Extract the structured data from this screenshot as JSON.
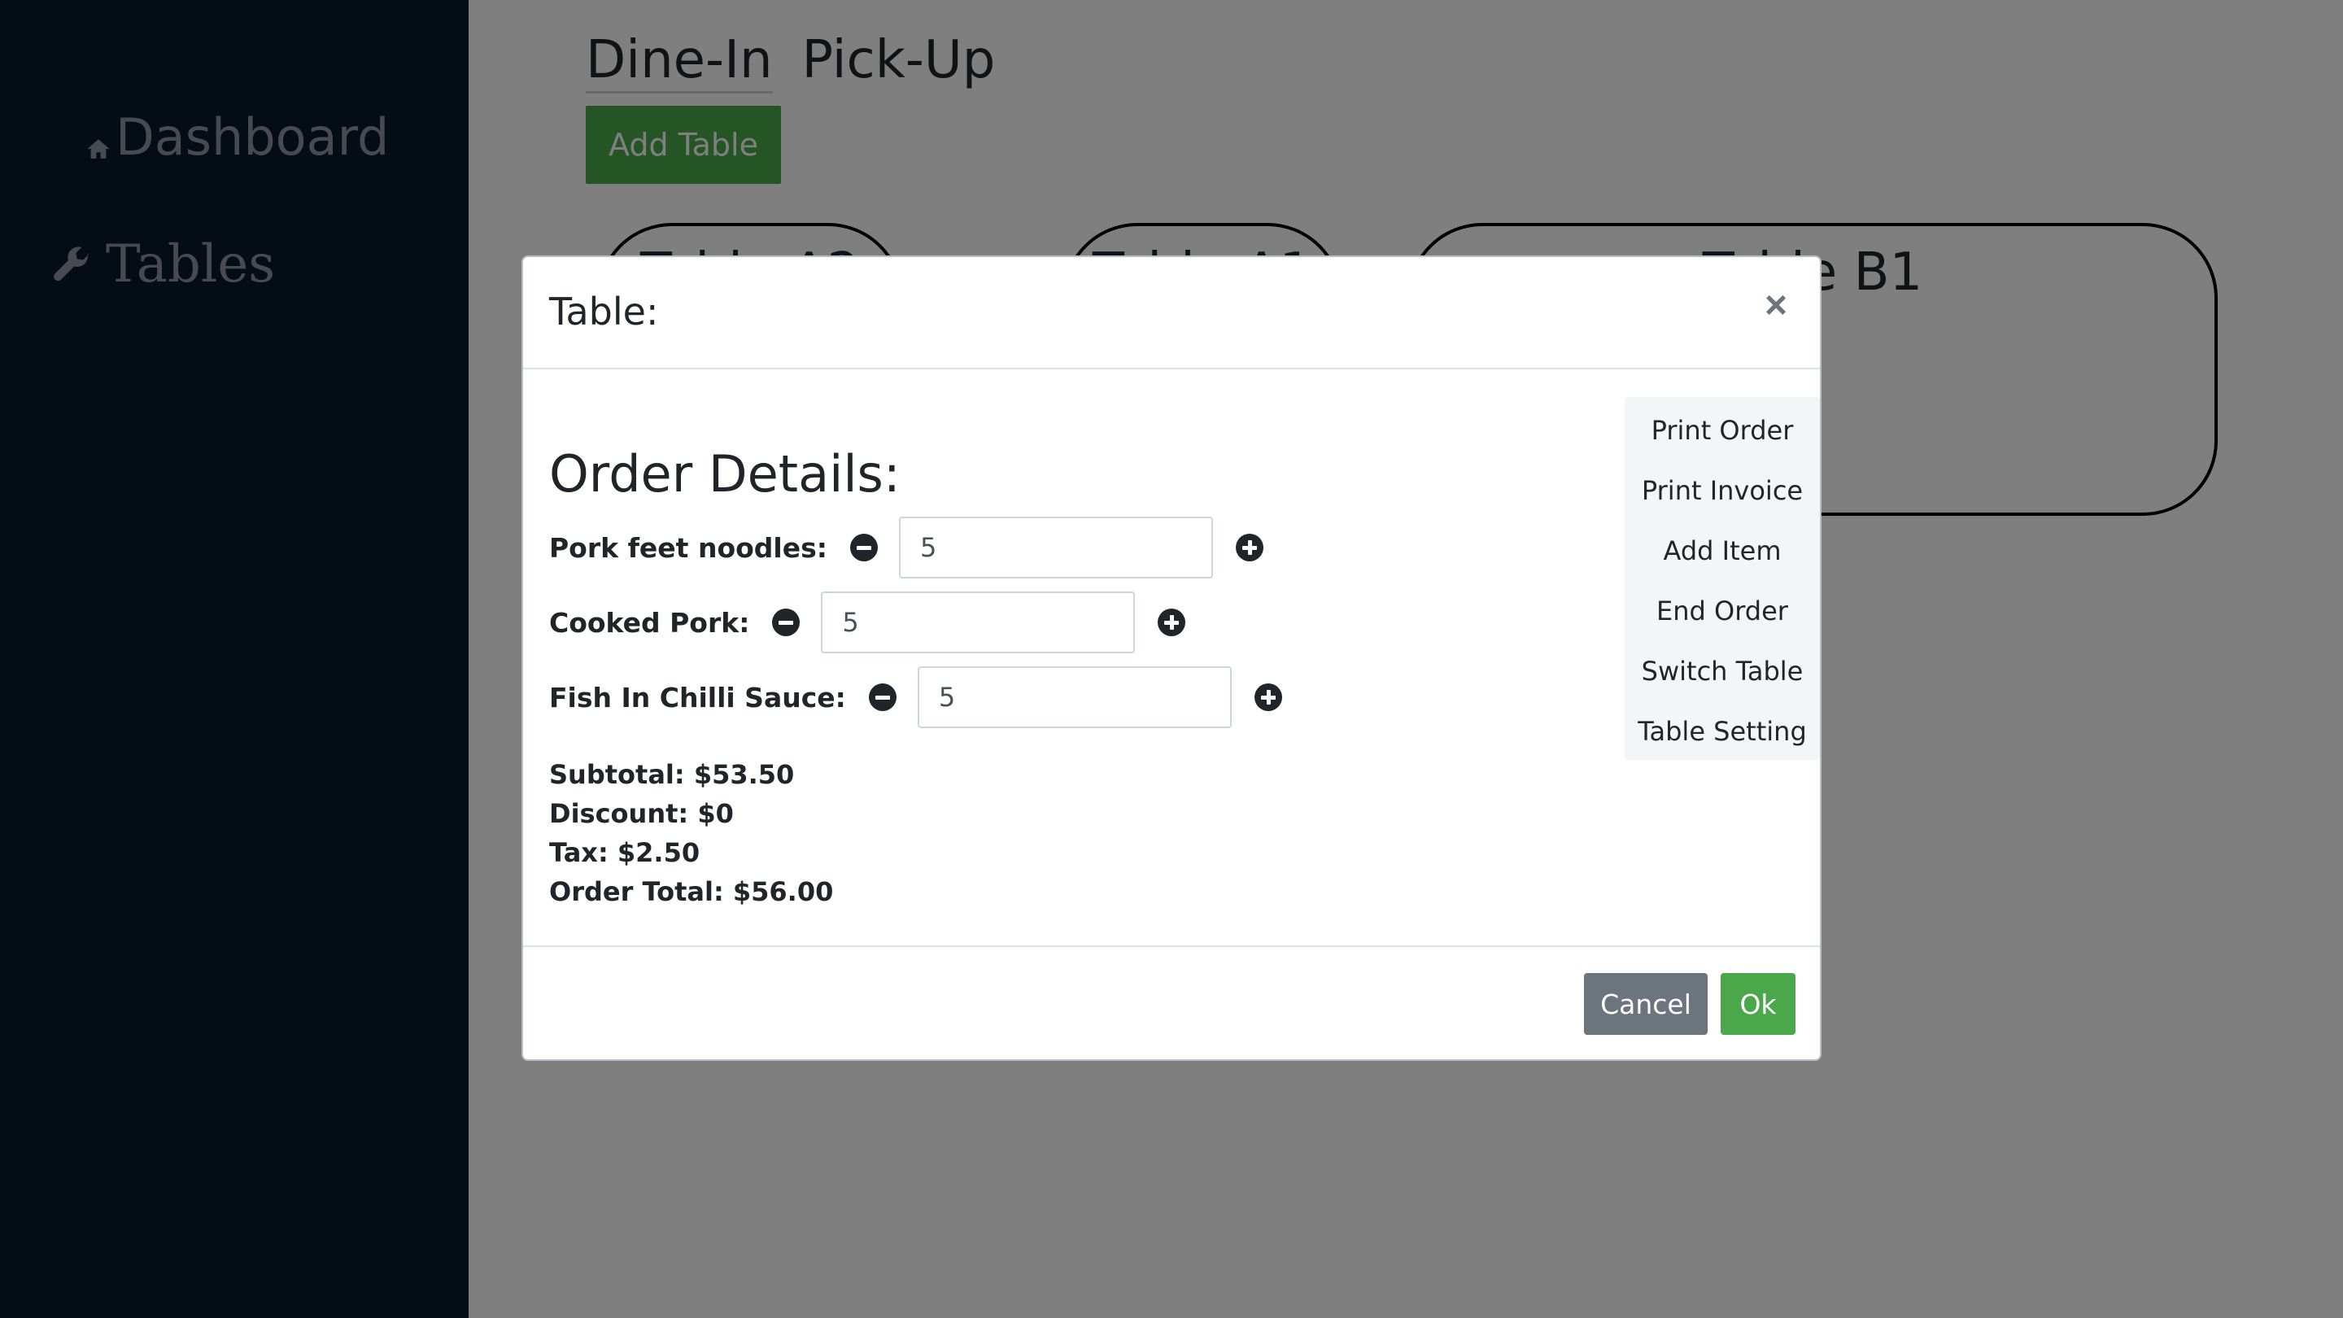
{
  "sidebar": {
    "items": [
      {
        "label": "Dashboard",
        "icon": "home-icon"
      },
      {
        "label": "Tables",
        "icon": "wrench-icon"
      }
    ]
  },
  "main": {
    "tabs": [
      {
        "label": "Dine-In",
        "active": true
      },
      {
        "label": "Pick-Up",
        "active": false
      }
    ],
    "add_table_label": "Add Table",
    "tables": [
      {
        "name": "Table A2"
      },
      {
        "name": "Table A1"
      },
      {
        "name": "Table B1"
      }
    ]
  },
  "modal": {
    "title": "Table:",
    "close_label": "×",
    "heading": "Order Details:",
    "items": [
      {
        "name": "Pork feet noodles:",
        "qty": "5"
      },
      {
        "name": "Cooked Pork:",
        "qty": "5"
      },
      {
        "name": "Fish In Chilli Sauce:",
        "qty": "5"
      }
    ],
    "totals": {
      "subtotal": "Subtotal: $53.50",
      "discount": "Discount: $0",
      "tax": "Tax: $2.50",
      "order_total": "Order Total: $56.00"
    },
    "actions": [
      "Print Order",
      "Print Invoice",
      "Add Item",
      "End Order",
      "Switch Table",
      "Table Setting"
    ],
    "cancel_label": "Cancel",
    "ok_label": "Ok"
  },
  "colors": {
    "sidebar_bg": "#081b2d",
    "accent_green": "#4aa84a",
    "secondary_gray": "#6c757d",
    "overlay": "rgba(0,0,0,0.5)"
  }
}
